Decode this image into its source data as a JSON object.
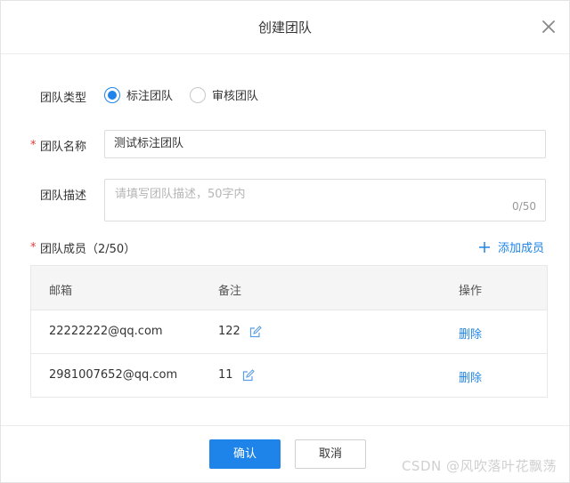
{
  "dialog": {
    "title": "创建团队"
  },
  "form": {
    "type_label": "团队类型",
    "type_options": [
      {
        "label": "标注团队",
        "checked": true
      },
      {
        "label": "审核团队",
        "checked": false
      }
    ],
    "name_label": "团队名称",
    "name_value": "测试标注团队",
    "desc_label": "团队描述",
    "desc_placeholder": "请填写团队描述，50字内",
    "desc_count": "0/50",
    "members_label": "团队成员（2/50）",
    "add_member_label": "添加成员",
    "required_mark": "*"
  },
  "table": {
    "headers": [
      "邮箱",
      "备注",
      "操作"
    ],
    "rows": [
      {
        "email": "22222222@qq.com",
        "note": "122",
        "action": "删除"
      },
      {
        "email": "2981007652@qq.com",
        "note": "11",
        "action": "删除"
      }
    ]
  },
  "footer": {
    "ok_label": "确认",
    "cancel_label": "取消"
  },
  "watermark": "CSDN @风吹落叶花飘荡",
  "colors": {
    "accent": "#1f84e9",
    "required": "#e23b3b"
  }
}
